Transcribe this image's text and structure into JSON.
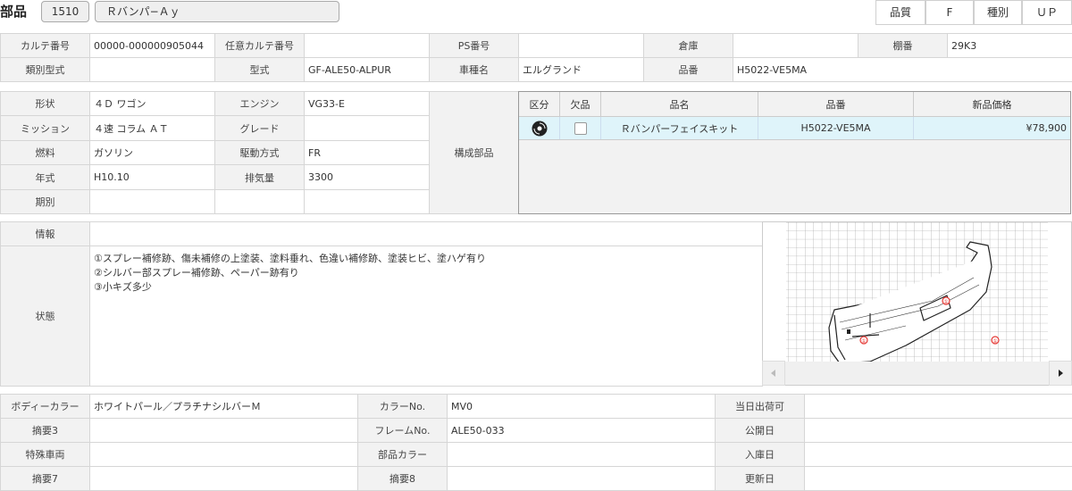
{
  "header": {
    "title": "部品",
    "code": "1510",
    "name": "Ｒバンパ−Ａｙ",
    "quality_label": "品質",
    "quality_value": "F",
    "type_label": "種別",
    "type_value": "ＵＰ"
  },
  "info1": {
    "karte_no_label": "カルテ番号",
    "karte_no": "00000-000000905044",
    "any_karte_label": "任意カルテ番号",
    "any_karte": "",
    "ps_label": "PS番号",
    "ps": "",
    "warehouse_label": "倉庫",
    "warehouse": "",
    "shelf_label": "棚番",
    "shelf": "29K3",
    "class_model_label": "類別型式",
    "class_model": "",
    "model_label": "型式",
    "model": "GF-ALE50-ALPUR",
    "car_name_label": "車種名",
    "car_name": "エルグランド",
    "part_no_label": "品番",
    "part_no": "H5022-VE5MA"
  },
  "spec": {
    "shape_label": "形状",
    "shape": "４Ｄ ワゴン",
    "engine_label": "エンジン",
    "engine": "VG33-E",
    "mission_label": "ミッション",
    "mission": "４速 コラム ＡＴ",
    "grade_label": "グレード",
    "grade": "",
    "fuel_label": "燃料",
    "fuel": "ガソリン",
    "drive_label": "駆動方式",
    "drive": "FR",
    "year_label": "年式",
    "year": "H10.10",
    "displacement_label": "排気量",
    "displacement": "3300",
    "period_label": "期別",
    "period": "",
    "components_label": "構成部品"
  },
  "parts": {
    "headers": [
      "区分",
      "欠品",
      "品名",
      "品番",
      "新品価格"
    ],
    "rows": [
      {
        "name": "Ｒバンパーフェイスキット",
        "part_no": "H5022-VE5MA",
        "price": "¥78,900"
      }
    ]
  },
  "condition": {
    "info_label": "情報",
    "info": "",
    "state_label": "状態",
    "lines": [
      "①スプレー補修跡、傷未補修の上塗装、塗料垂れ、色違い補修跡、塗装ヒビ、塗ハゲ有り",
      "②シルバー部スプレー補修跡、ペーパー跡有り",
      "③小キズ多少"
    ]
  },
  "image": {
    "markers": [
      "①",
      "①",
      "①"
    ],
    "prev_icon": "triangle-left",
    "next_icon": "triangle-right"
  },
  "bottom": {
    "body_color_label": "ボディーカラー",
    "body_color": "ホワイトパール／プラチナシルバーＭ",
    "color_no_label": "カラーNo.",
    "color_no": "MV0",
    "same_day_label": "当日出荷可",
    "same_day": "",
    "memo3_label": "摘要3",
    "memo3": "",
    "frame_label": "フレームNo.",
    "frame": "ALE50-033",
    "public_date_label": "公開日",
    "public_date": "",
    "special_label": "特殊車両",
    "special": "",
    "part_color_label": "部品カラー",
    "part_color": "",
    "arrival_label": "入庫日",
    "arrival": "",
    "memo7_label": "摘要7",
    "memo7": "",
    "memo8_label": "摘要8",
    "memo8": "",
    "update_label": "更新日",
    "update": ""
  },
  "colors": {
    "label_bg": "#f2f2f2",
    "border": "#d6d6d6",
    "row_highlight": "#dff4fa",
    "marker": "#e53935"
  }
}
